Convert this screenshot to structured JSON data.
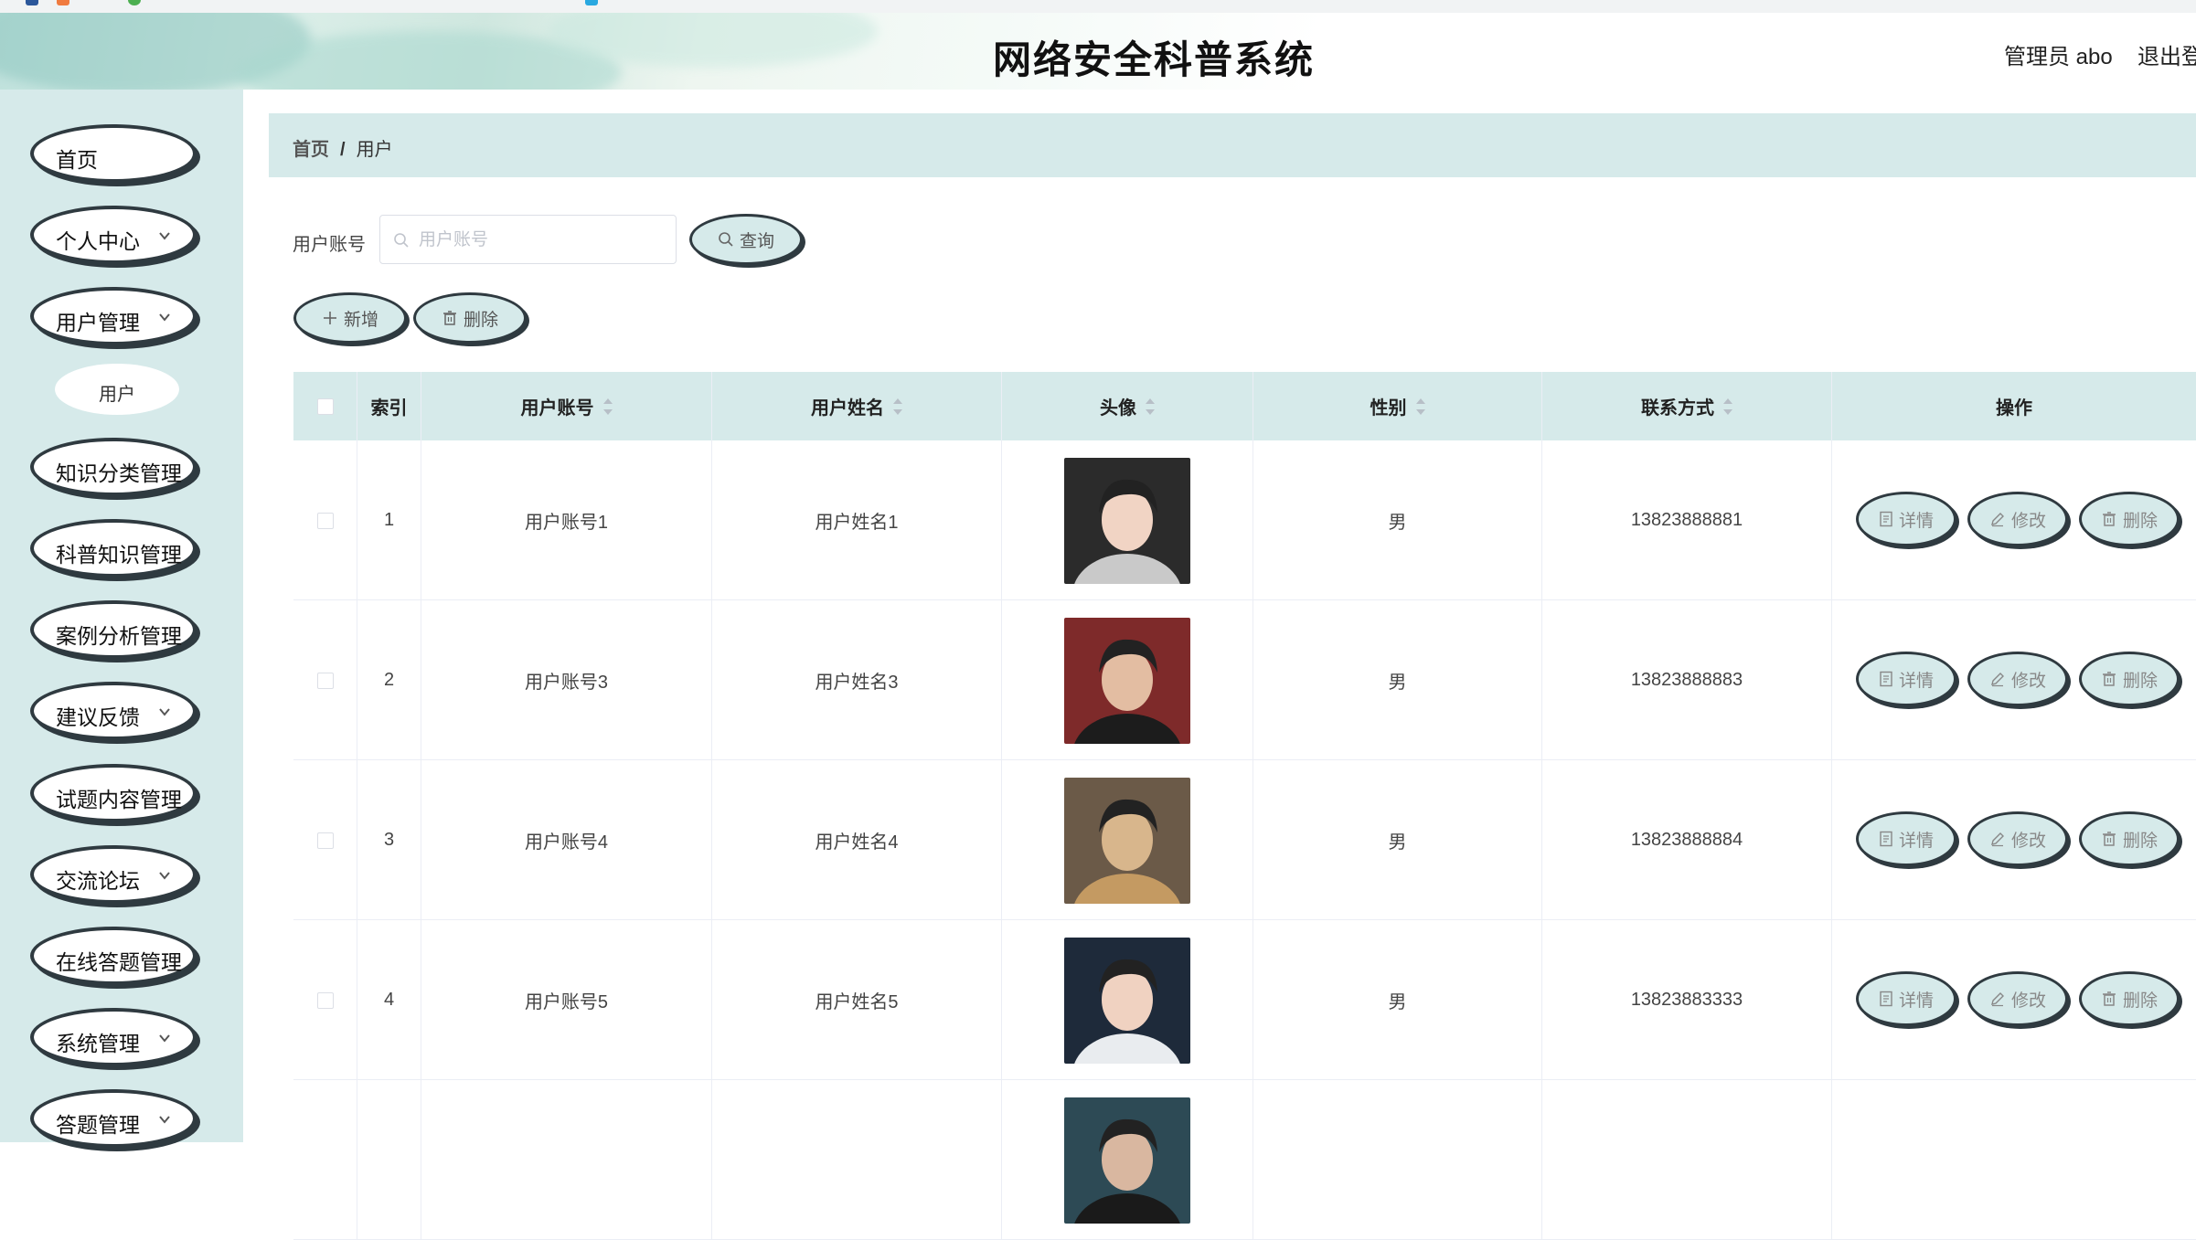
{
  "header": {
    "title": "网络安全科普系统",
    "user": "管理员 abo",
    "logout": "退出登"
  },
  "sidebar": {
    "items": [
      {
        "label": "首页",
        "expandable": false
      },
      {
        "label": "个人中心",
        "expandable": true
      },
      {
        "label": "用户管理",
        "expandable": true
      },
      {
        "label": "知识分类管理",
        "expandable": true
      },
      {
        "label": "科普知识管理",
        "expandable": true
      },
      {
        "label": "案例分析管理",
        "expandable": true
      },
      {
        "label": "建议反馈",
        "expandable": true
      },
      {
        "label": "试题内容管理",
        "expandable": true
      },
      {
        "label": "交流论坛",
        "expandable": true
      },
      {
        "label": "在线答题管理",
        "expandable": true
      },
      {
        "label": "系统管理",
        "expandable": true
      },
      {
        "label": "答题管理",
        "expandable": true
      }
    ],
    "sub_item": "用户"
  },
  "breadcrumb": {
    "home": "首页",
    "separator": "/",
    "current": "用户"
  },
  "search": {
    "label": "用户账号",
    "placeholder": "用户账号",
    "value": "",
    "button": "查询"
  },
  "toolbar": {
    "add": "新增",
    "delete": "删除"
  },
  "table": {
    "columns": {
      "index": "索引",
      "account": "用户账号",
      "name": "用户姓名",
      "avatar": "头像",
      "gender": "性别",
      "phone": "联系方式",
      "actions": "操作"
    },
    "actions": {
      "detail": "详情",
      "edit": "修改",
      "delete": "删除"
    },
    "rows": [
      {
        "index": "1",
        "account": "用户账号1",
        "name": "用户姓名1",
        "gender": "男",
        "phone": "13823888881"
      },
      {
        "index": "2",
        "account": "用户账号3",
        "name": "用户姓名3",
        "gender": "男",
        "phone": "13823888883"
      },
      {
        "index": "3",
        "account": "用户账号4",
        "name": "用户姓名4",
        "gender": "男",
        "phone": "13823888884"
      },
      {
        "index": "4",
        "account": "用户账号5",
        "name": "用户姓名5",
        "gender": "男",
        "phone": "13823883333"
      },
      {
        "index": "",
        "account": "",
        "name": "",
        "gender": "",
        "phone": ""
      }
    ]
  },
  "colors": {
    "accent": "#d6eaea",
    "border": "#2f3a40",
    "text": "#303133"
  }
}
